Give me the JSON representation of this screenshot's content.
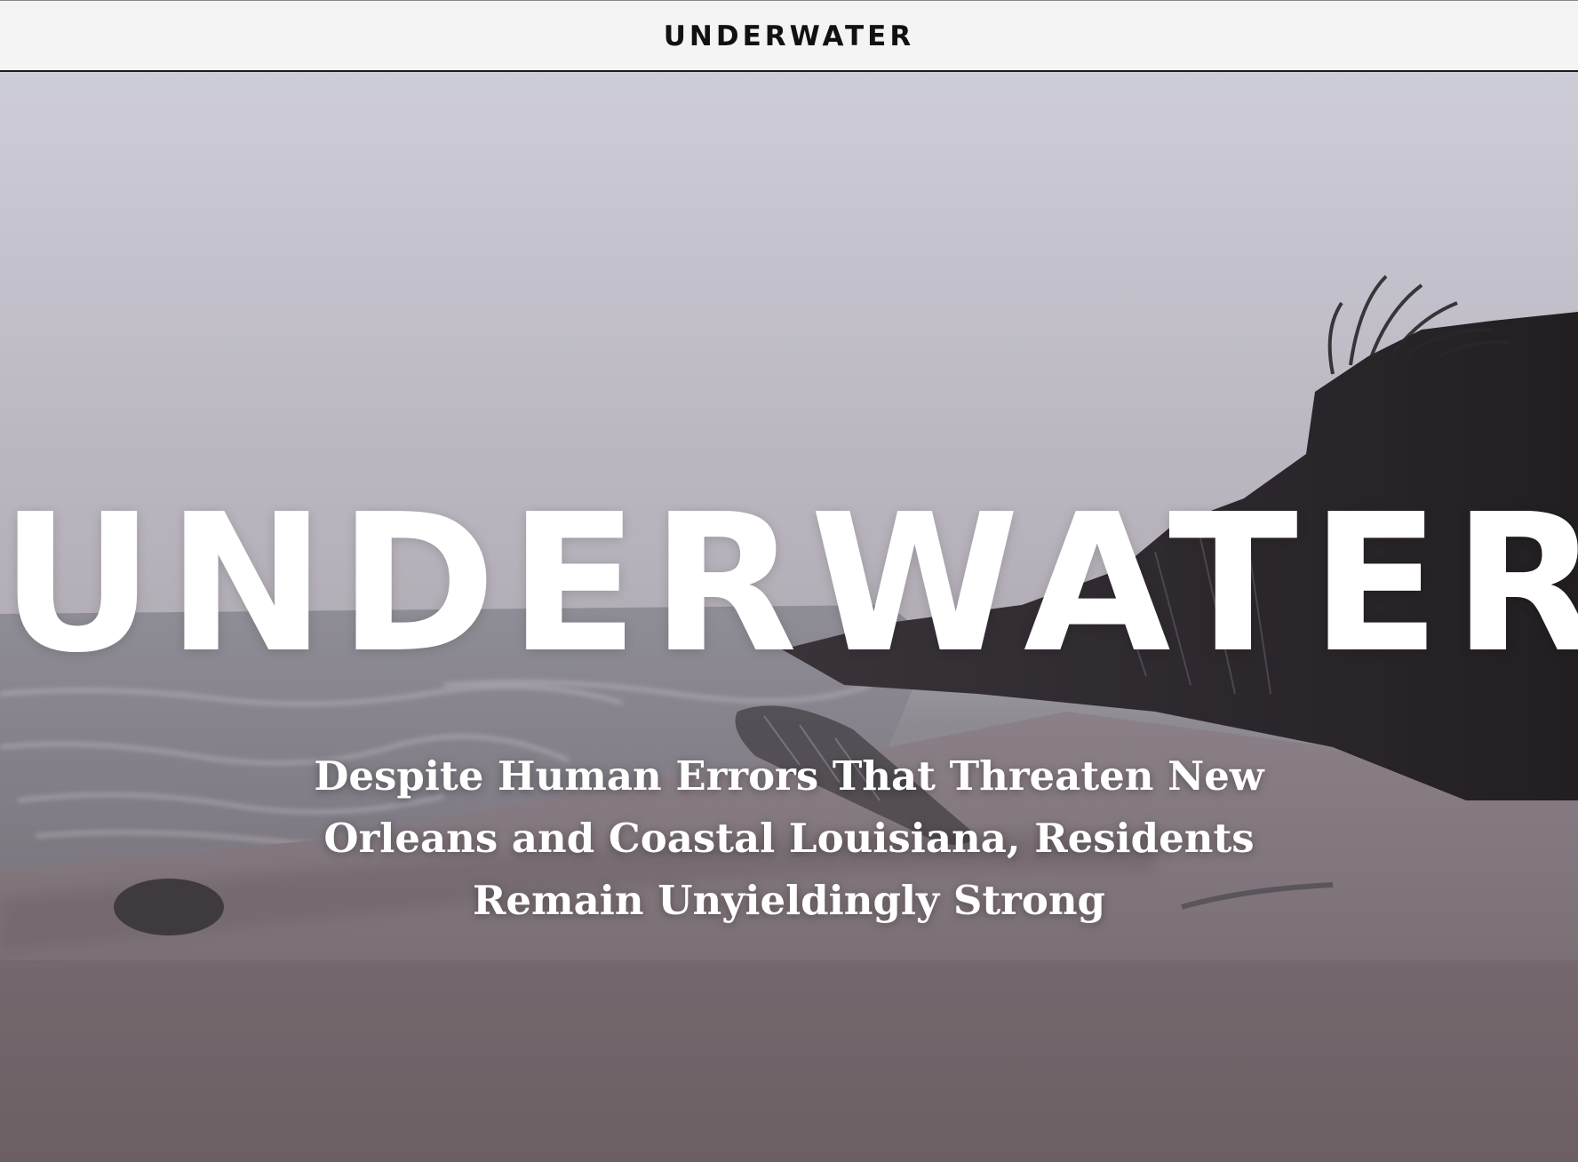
{
  "header": {
    "title": "UNDERWATER"
  },
  "hero": {
    "title": "UNDERWATER",
    "subtitle": "Despite Human Errors That Threaten New Orleans and Coastal Louisiana, Residents Remain Unyieldingly Strong",
    "background_image": "beach-cliff-erosion-photo"
  },
  "colors": {
    "header_bg": "#f4f4f4",
    "header_text": "#111111",
    "hero_text": "#ffffff"
  }
}
